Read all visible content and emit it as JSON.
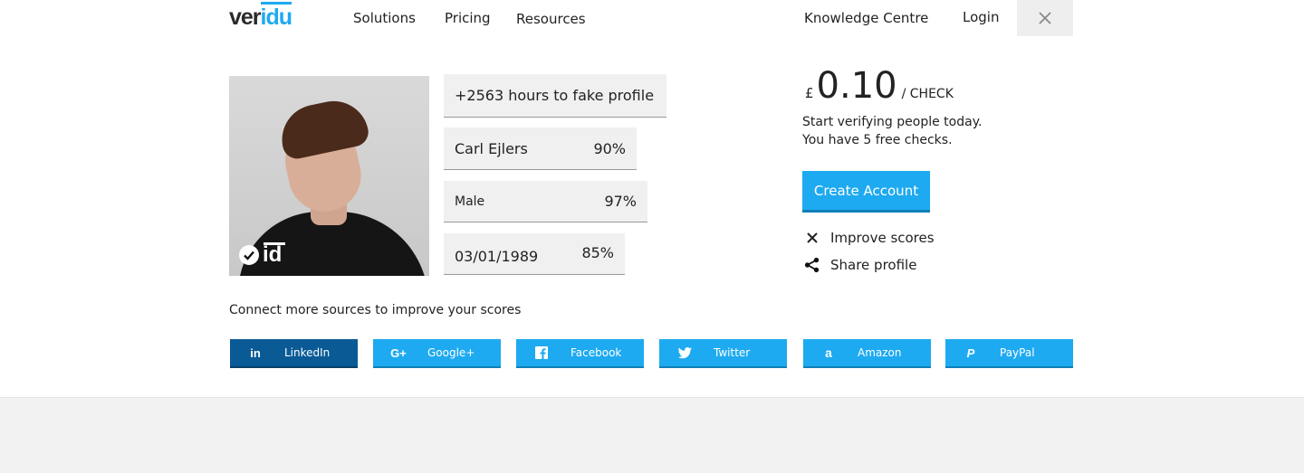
{
  "nav": {
    "logo": {
      "part1": "ver",
      "part2": "idu"
    },
    "links": [
      "Solutions",
      "Pricing",
      "Resources"
    ],
    "knowledge": "Knowledge Centre",
    "login": "Login"
  },
  "profile": {
    "hours": "+2563 hours to fake profile",
    "name": {
      "label": "Carl Ejlers",
      "score": "90%"
    },
    "gender": {
      "label": "Male",
      "score": "97%"
    },
    "dob": {
      "label": "03/01/1989",
      "score": "85%"
    }
  },
  "pricing": {
    "currency": "£",
    "amount": "0.10",
    "per": "/ CHECK",
    "line1": "Start verifying people today.",
    "line2": "You have 5 free checks.",
    "cta": "Create Account"
  },
  "actions": {
    "improve": "Improve scores",
    "share": "Share profile"
  },
  "connect": {
    "heading": "Connect more sources to improve your scores",
    "sources": [
      "LinkedIn",
      "Google+",
      "Facebook",
      "Twitter",
      "Amazon",
      "PayPal"
    ]
  },
  "colors": {
    "accent": "#1eaaf1",
    "linkedin_active": "#0a5a96"
  }
}
